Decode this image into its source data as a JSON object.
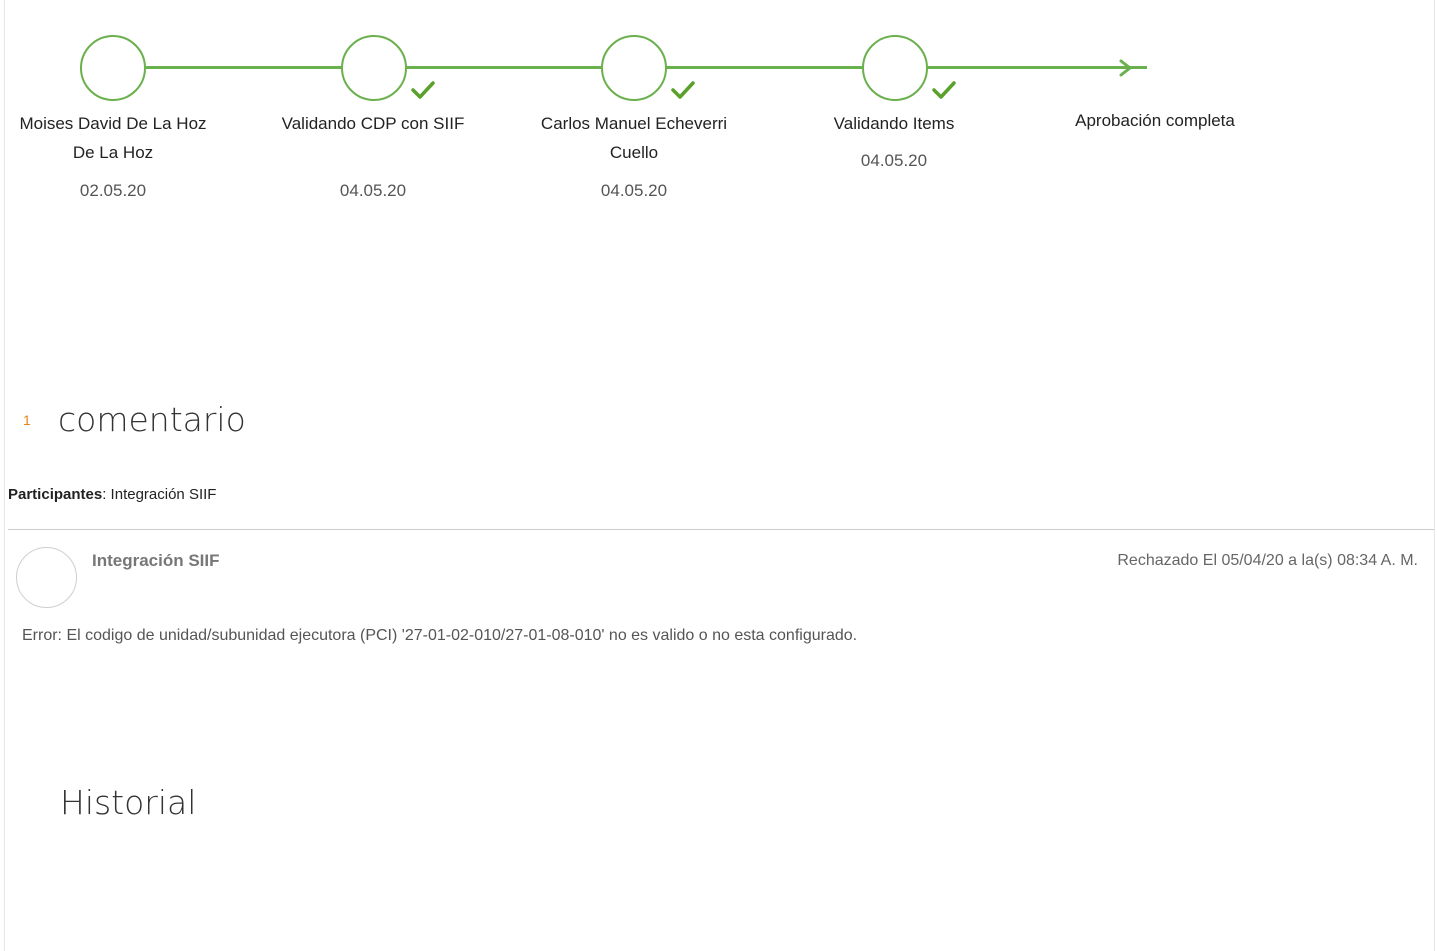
{
  "workflow": {
    "steps": [
      {
        "name": "Moises David De La Hoz De La Hoz",
        "date": "02.05.20",
        "check": false
      },
      {
        "name": "Validando CDP con SIIF",
        "date": "04.05.20",
        "check": true
      },
      {
        "name": "Carlos Manuel Echeverri Cuello",
        "date": "04.05.20",
        "check": true
      },
      {
        "name": "Validando Items",
        "date": "04.05.20",
        "check": true
      }
    ],
    "final_label": "Aprobación completa",
    "accent_color": "#6ab04c"
  },
  "comments": {
    "count": "1",
    "title": "comentario",
    "participants_label": "Participantes",
    "participants_value": ": Integración SIIF",
    "items": [
      {
        "author": "Integración SIIF",
        "status": "Rechazado El 05/04/20 a la(s) 08:34 A. M.",
        "body": "Error: El codigo de unidad/subunidad ejecutora (PCI) '27-01-02-010/27-01-08-010' no es valido o no esta configurado."
      }
    ]
  },
  "history": {
    "title": "Historial"
  },
  "colors": {
    "count_orange": "#e8821a",
    "divider": "#cccccc"
  }
}
